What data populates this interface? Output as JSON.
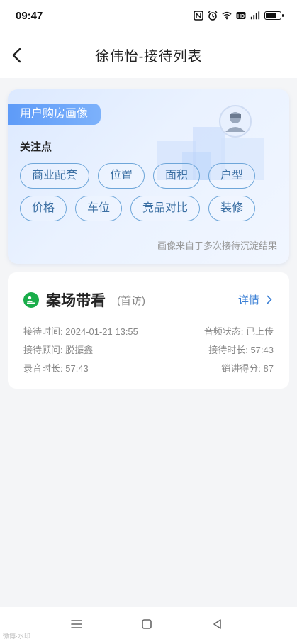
{
  "status_bar": {
    "time": "09:47",
    "icons": [
      "nfc-icon",
      "alarm-icon",
      "wifi-icon",
      "hd-icon",
      "signal-icon",
      "battery-icon"
    ]
  },
  "header": {
    "title": "徐伟怡-接待列表"
  },
  "portrait": {
    "badge": "用户购房画像",
    "focus_title": "关注点",
    "tags_row1": [
      "商业配套",
      "位置",
      "面积",
      "户型"
    ],
    "tags_row2": [
      "价格",
      "车位",
      "竞品对比",
      "装修"
    ],
    "note": "画像来自于多次接待沉淀结果"
  },
  "visit": {
    "title": "案场带看",
    "subtitle": "(首访)",
    "detail_label": "详情",
    "reception_time_label": "接待时间:",
    "reception_time": "2024-01-21 13:55",
    "audio_status_label": "音频状态:",
    "audio_status": "已上传",
    "consultant_label": "接待顾问:",
    "consultant": "脱振鑫",
    "duration_label": "接待时长:",
    "duration": "57:43",
    "recording_label": "录音时长:",
    "recording": "57:43",
    "score_label": "销讲得分:",
    "score": "87"
  },
  "nav": {
    "icons": [
      "menu-icon",
      "home-icon",
      "back-triangle-icon"
    ]
  },
  "colors": {
    "accent_blue": "#3a7fd5",
    "tag_border": "#6ea6d9",
    "badge_blue": "#5e9bf8",
    "visit_icon_green": "#1aad4a"
  },
  "watermark": "微博·水印"
}
